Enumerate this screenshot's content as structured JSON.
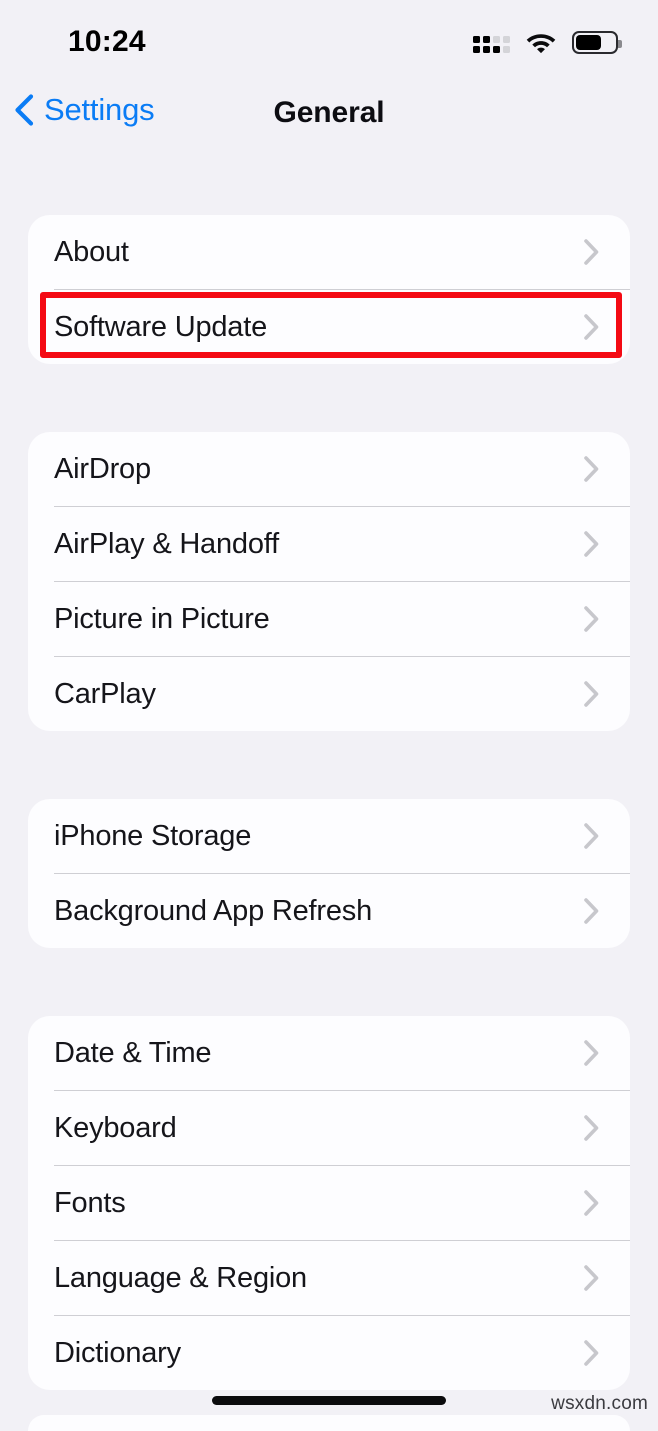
{
  "status_bar": {
    "time": "10:24",
    "cellular_icon": "cellular-signal-icon",
    "wifi_icon": "wifi-icon",
    "battery_icon": "battery-icon",
    "battery_level_percent": 65
  },
  "nav": {
    "back_label": "Settings",
    "back_icon": "chevron-left-icon",
    "title": "General"
  },
  "colors": {
    "background": "#f2f1f6",
    "card": "#fdfdff",
    "accent_blue": "#0a7cf5",
    "highlight_red": "#f40a14",
    "chevron_gray": "#c7c7cc",
    "separator": "#cfcfd4",
    "label_text": "#15151a"
  },
  "groups": [
    {
      "id": "group-system",
      "rows": [
        {
          "label": "About",
          "chevron": "chevron-right-icon"
        },
        {
          "label": "Software Update",
          "chevron": "chevron-right-icon",
          "highlighted": true
        }
      ]
    },
    {
      "id": "group-connectivity",
      "rows": [
        {
          "label": "AirDrop",
          "chevron": "chevron-right-icon"
        },
        {
          "label": "AirPlay & Handoff",
          "chevron": "chevron-right-icon"
        },
        {
          "label": "Picture in Picture",
          "chevron": "chevron-right-icon"
        },
        {
          "label": "CarPlay",
          "chevron": "chevron-right-icon"
        }
      ]
    },
    {
      "id": "group-storage",
      "rows": [
        {
          "label": "iPhone Storage",
          "chevron": "chevron-right-icon"
        },
        {
          "label": "Background App Refresh",
          "chevron": "chevron-right-icon"
        }
      ]
    },
    {
      "id": "group-localization",
      "rows": [
        {
          "label": "Date & Time",
          "chevron": "chevron-right-icon"
        },
        {
          "label": "Keyboard",
          "chevron": "chevron-right-icon"
        },
        {
          "label": "Fonts",
          "chevron": "chevron-right-icon"
        },
        {
          "label": "Language & Region",
          "chevron": "chevron-right-icon"
        },
        {
          "label": "Dictionary",
          "chevron": "chevron-right-icon"
        }
      ]
    }
  ],
  "watermark": "wsxdn.com"
}
